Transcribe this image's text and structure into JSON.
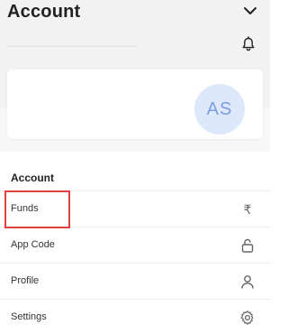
{
  "header": {
    "title": "Account"
  },
  "profile_card": {
    "avatar_initials": "AS",
    "avatar_bg": "#dde8fa",
    "avatar_fg": "#7c9ee3"
  },
  "account_section": {
    "title": "Account",
    "items": [
      {
        "label": "Funds",
        "icon": "rupee-icon"
      },
      {
        "label": "App Code",
        "icon": "lock-open-icon"
      },
      {
        "label": "Profile",
        "icon": "user-icon"
      },
      {
        "label": "Settings",
        "icon": "gear-icon"
      }
    ]
  },
  "highlight_color": "#e0403f"
}
